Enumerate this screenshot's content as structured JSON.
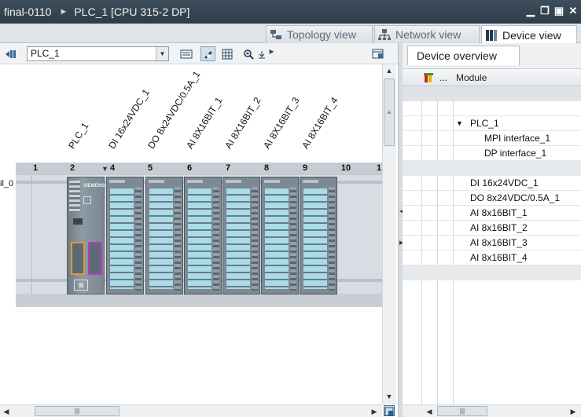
{
  "titlebar": {
    "project": "final-0110",
    "device": "PLC_1 [CPU 315-2 DP]",
    "minimize": "▁",
    "restore": "❐",
    "maximize": "▣",
    "close": "✕"
  },
  "view_tabs": [
    {
      "label": "Topology view",
      "active": false
    },
    {
      "label": "Network view",
      "active": false
    },
    {
      "label": "Device view",
      "active": true
    }
  ],
  "toolbar": {
    "device_select_value": "PLC_1"
  },
  "rack": {
    "module_labels": [
      "PLC_1",
      "DI 16x24VDC_1",
      "DO 8x24VDC/0.5A_1",
      "AI 8X16BIT_1",
      "AI 8X16BIT_2",
      "AI 8X16BIT_3",
      "AI 8X16BIT_4"
    ],
    "slot_numbers": [
      "1",
      "2",
      "4",
      "5",
      "6",
      "7",
      "8",
      "9",
      "10",
      "1"
    ],
    "rail_label": "il_0",
    "cpu_brand": "SIEMENS"
  },
  "device_overview": {
    "tab_label": "Device overview",
    "column_module": "Module",
    "column_dots": "...",
    "rows": [
      {
        "text": "",
        "indent": 0,
        "style": "selrow"
      },
      {
        "text": "",
        "indent": 0,
        "style": "plain"
      },
      {
        "text": "PLC_1",
        "indent": 1,
        "style": "plain",
        "expand": "▼"
      },
      {
        "text": "MPI interface_1",
        "indent": 2,
        "style": "plain"
      },
      {
        "text": "DP interface_1",
        "indent": 2,
        "style": "plain"
      },
      {
        "text": "",
        "indent": 0,
        "style": "shaded"
      },
      {
        "text": "DI 16x24VDC_1",
        "indent": 0,
        "style": "plain"
      },
      {
        "text": "DO 8x24VDC/0.5A_1",
        "indent": 0,
        "style": "plain"
      },
      {
        "text": "AI 8x16BIT_1",
        "indent": 0,
        "style": "plain"
      },
      {
        "text": "AI 8x16BIT_2",
        "indent": 0,
        "style": "plain"
      },
      {
        "text": "AI 8x16BIT_3",
        "indent": 0,
        "style": "plain"
      },
      {
        "text": "AI 8x16BIT_4",
        "indent": 0,
        "style": "plain"
      },
      {
        "text": "",
        "indent": 0,
        "style": "shaded"
      }
    ]
  },
  "colors": {
    "titlebar": "#34414e",
    "module_screen": "#a9dbe8",
    "module_body": "#7d8993",
    "rack": "#d8dde3"
  }
}
